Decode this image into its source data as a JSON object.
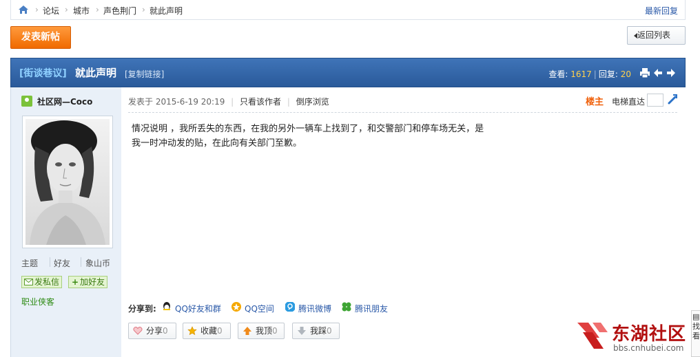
{
  "breadcrumb": {
    "items": [
      "论坛",
      "城市",
      "声色荆门",
      "就此声明"
    ],
    "latest_reply": "最新回复"
  },
  "toolbar": {
    "post_button": "发表新帖",
    "back_button": "返回列表"
  },
  "thread": {
    "category": "[街谈巷议]",
    "title": "就此声明",
    "copy_link": "[复制链接]",
    "views_label": "查看:",
    "views": "1617",
    "replies_label": "回复:",
    "replies": "20"
  },
  "author": {
    "name": "社区网—Coco",
    "stats": [
      "主题",
      "好友",
      "象山币"
    ],
    "send_message": "发私信",
    "add_friend": "加好友",
    "rank": "职业侠客"
  },
  "post": {
    "posted_prefix": "发表于",
    "posted_time": "2015-6-19 20:19",
    "only_author": "只看该作者",
    "reverse_order": "倒序浏览",
    "floor": "楼主",
    "jump_label": "电梯直达",
    "body": "情况说明 ，我所丢失的东西，在我的另外一辆车上找到了，和交警部门和停车场无关，是我一时冲动发的贴，在此向有关部门至歉。"
  },
  "share": {
    "label": "分享到:",
    "items": [
      {
        "label": "QQ好友和群",
        "icon": "qq-icon",
        "color": "#f5c400"
      },
      {
        "label": "QQ空间",
        "icon": "qzone-icon",
        "color": "#f5a800"
      },
      {
        "label": "腾讯微博",
        "icon": "tencent-weibo-icon",
        "color": "#2b9be0"
      },
      {
        "label": "腾讯朋友",
        "icon": "tencent-friends-icon",
        "color": "#3fa535"
      }
    ]
  },
  "votes": [
    {
      "label": "分享",
      "count": "0",
      "icon": "heart-icon"
    },
    {
      "label": "收藏",
      "count": "0",
      "icon": "star-icon"
    },
    {
      "label": "我顶",
      "count": "0",
      "icon": "arrow-up-icon"
    },
    {
      "label": "我踩",
      "count": "0",
      "icon": "arrow-down-icon"
    }
  ],
  "watermark": {
    "title": "东湖社区",
    "url": "bbs.cnhubei.com"
  },
  "side_float": {
    "chars": [
      "找",
      "看"
    ]
  },
  "colors": {
    "accent": "#2a59a8",
    "header_band": "#2f63a8",
    "post_button": "#f27a10",
    "floor": "#f0600a"
  }
}
